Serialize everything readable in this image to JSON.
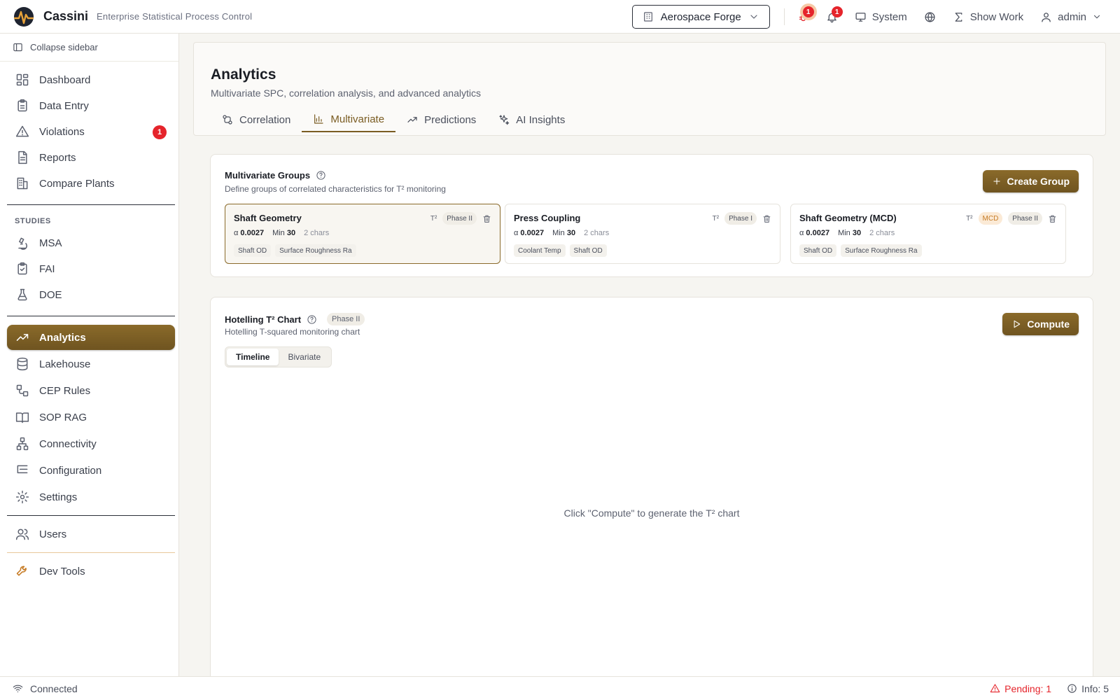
{
  "app": {
    "name": "Cassini",
    "subtitle": "Enterprise Statistical Process Control",
    "brand_color": "#7a5c22"
  },
  "header": {
    "plant_selector": "Aerospace Forge",
    "alerts_badge": "1",
    "notifications_badge": "1",
    "system_label": "System",
    "show_work_label": "Show Work",
    "user_label": "admin"
  },
  "sidebar": {
    "collapse_label": "Collapse sidebar",
    "items": [
      {
        "label": "Dashboard",
        "icon": "layout-grid-icon"
      },
      {
        "label": "Data Entry",
        "icon": "clipboard-icon"
      },
      {
        "label": "Violations",
        "icon": "alert-triangle-icon",
        "badge": "1"
      },
      {
        "label": "Reports",
        "icon": "file-text-icon"
      },
      {
        "label": "Compare Plants",
        "icon": "building-icon"
      }
    ],
    "studies_heading": "STUDIES",
    "studies": [
      {
        "label": "MSA",
        "icon": "microscope-icon"
      },
      {
        "label": "FAI",
        "icon": "clipboard-check-icon"
      },
      {
        "label": "DOE",
        "icon": "flask-icon"
      }
    ],
    "tools": [
      {
        "label": "Analytics",
        "icon": "trending-up-icon",
        "active": true
      },
      {
        "label": "Lakehouse",
        "icon": "database-icon"
      },
      {
        "label": "CEP Rules",
        "icon": "workflow-icon"
      },
      {
        "label": "SOP RAG",
        "icon": "book-open-icon"
      },
      {
        "label": "Connectivity",
        "icon": "network-icon"
      },
      {
        "label": "Configuration",
        "icon": "list-tree-icon"
      },
      {
        "label": "Settings",
        "icon": "gear-icon"
      }
    ],
    "admin": [
      {
        "label": "Users",
        "icon": "users-icon"
      }
    ],
    "dev": [
      {
        "label": "Dev Tools",
        "icon": "wrench-icon"
      }
    ]
  },
  "page": {
    "title": "Analytics",
    "subtitle": "Multivariate SPC, correlation analysis, and advanced analytics",
    "tabs": [
      {
        "label": "Correlation",
        "icon": "git-compare-icon"
      },
      {
        "label": "Multivariate",
        "icon": "bar-chart-icon",
        "active": true
      },
      {
        "label": "Predictions",
        "icon": "trending-up-icon"
      },
      {
        "label": "AI Insights",
        "icon": "sparkles-icon"
      }
    ]
  },
  "groups_card": {
    "title": "Multivariate Groups",
    "subtitle": "Define groups of correlated characteristics for T² monitoring",
    "create_label": "Create Group",
    "groups": [
      {
        "name": "Shaft Geometry",
        "t2": "T²",
        "mcd": "",
        "phase": "Phase II",
        "alpha_symbol": "α",
        "alpha": "0.0027",
        "min_label": "Min",
        "min": "30",
        "chars_count": "2 chars",
        "chars": [
          "Shaft OD",
          "Surface Roughness Ra"
        ],
        "selected": true
      },
      {
        "name": "Press Coupling",
        "t2": "T²",
        "mcd": "",
        "phase": "Phase I",
        "alpha_symbol": "α",
        "alpha": "0.0027",
        "min_label": "Min",
        "min": "30",
        "chars_count": "2 chars",
        "chars": [
          "Coolant Temp",
          "Shaft OD"
        ],
        "selected": false
      },
      {
        "name": "Shaft Geometry (MCD)",
        "t2": "T²",
        "mcd": "MCD",
        "phase": "Phase II",
        "alpha_symbol": "α",
        "alpha": "0.0027",
        "min_label": "Min",
        "min": "30",
        "chars_count": "2 chars",
        "chars": [
          "Shaft OD",
          "Surface Roughness Ra"
        ],
        "selected": false
      }
    ]
  },
  "chart_card": {
    "title": "Hotelling T² Chart",
    "phase": "Phase II",
    "subtitle": "Hotelling T-squared monitoring chart",
    "compute_label": "Compute",
    "views": [
      {
        "label": "Timeline",
        "active": true
      },
      {
        "label": "Bivariate",
        "active": false
      }
    ],
    "empty_message": "Click \"Compute\" to generate the T² chart"
  },
  "statusbar": {
    "connection": "Connected",
    "pending": "Pending: 1",
    "info": "Info: 5"
  }
}
